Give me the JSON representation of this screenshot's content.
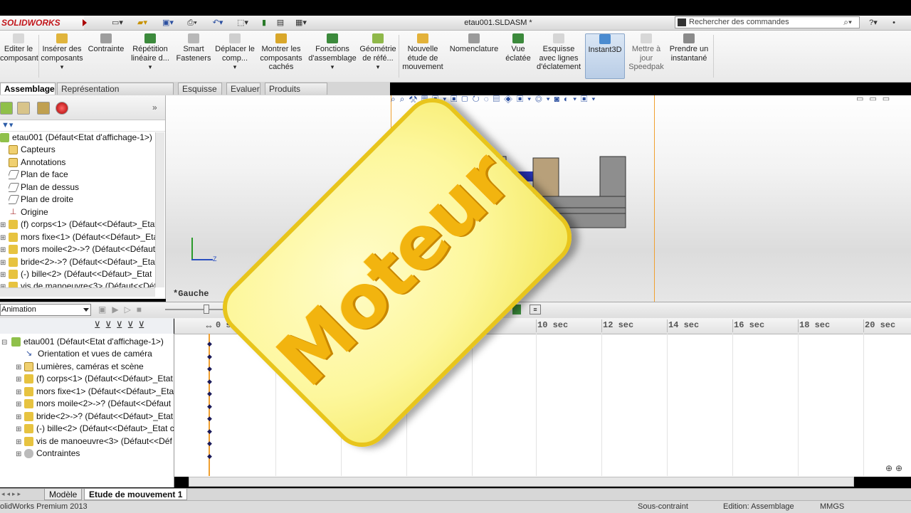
{
  "app": {
    "brand": "SOLIDWORKS",
    "document_title": "etau001.SLDASM *",
    "search_placeholder": "Rechercher des commandes"
  },
  "command_manager": [
    {
      "label": "Editer le composant"
    },
    {
      "label": "Insérer des composants"
    },
    {
      "label": "Contrainte"
    },
    {
      "label": "Répétition linéaire d..."
    },
    {
      "label": "Smart Fasteners"
    },
    {
      "label": "Déplacer le comp..."
    },
    {
      "label": "Montrer les composants cachés"
    },
    {
      "label": "Fonctions d'assemblage"
    },
    {
      "label": "Géométrie de réfé..."
    },
    {
      "label": "Nouvelle étude de mouvement"
    },
    {
      "label": "Nomenclature"
    },
    {
      "label": "Vue éclatée"
    },
    {
      "label": "Esquisse avec lignes d'éclatement"
    },
    {
      "label": "Instant3D"
    },
    {
      "label": "Mettre à jour Speedpak"
    },
    {
      "label": "Prendre un instantané"
    }
  ],
  "tabs": [
    "Assemblage",
    "Représentation schématique",
    "Esquisse",
    "Evaluer",
    "Produits Office"
  ],
  "feature_tree": {
    "root": "etau001  (Défaut<Etat d'affichage-1>)",
    "items": [
      "Capteurs",
      "Annotations",
      "Plan de face",
      "Plan de dessus",
      "Plan de droite",
      "Origine",
      "(f) corps<1> (Défaut<<Défaut>_Etat",
      "mors fixe<1> (Défaut<<Défaut>_Etat",
      "mors moile<2>->? (Défaut<<Défaut",
      "bride<2>->? (Défaut<<Défaut>_Etat",
      "(-) bille<2> (Défaut<<Défaut>_Etat",
      "vis de manoeuvre<3> (Défaut<<Déf"
    ]
  },
  "viewport": {
    "view_label": "*Gauche",
    "axis_z": "Z"
  },
  "motion": {
    "study_type": "Animation",
    "tree_root": "etau001  (Défaut<Etat d'affichage-1>)",
    "tree_items": [
      "Orientation et vues de caméra",
      "Lumières, caméras et scène",
      "(f) corps<1>  (Défaut<<Défaut>_Etat",
      "mors fixe<1>  (Défaut<<Défaut>_Eta",
      "mors moile<2>->?  (Défaut<<Défaut",
      "bride<2>->?  (Défaut<<Défaut>_Etat",
      "(-) bille<2>  (Défaut<<Défaut>_Etat c",
      "vis de manoeuvre<3>  (Défaut<<Déf",
      "Contraintes"
    ],
    "timeline_labels": [
      "0 sec",
      "10 sec",
      "12 sec",
      "14 sec",
      "16 sec",
      "18 sec",
      "20 sec"
    ]
  },
  "bottom_tabs": [
    "Modèle",
    "Etude de mouvement 1"
  ],
  "status": {
    "left": "olidWorks Premium 2013",
    "middle": "Sous-contraint",
    "edit": "Edition: Assemblage",
    "units": "MMGS"
  },
  "overlay_text": "Moteur",
  "colors": {
    "overlay_fill": "#fdf79c",
    "overlay_border": "#e8c51c",
    "overlay_text": "#f2b40f",
    "timeline_bar": "#f0a030"
  }
}
